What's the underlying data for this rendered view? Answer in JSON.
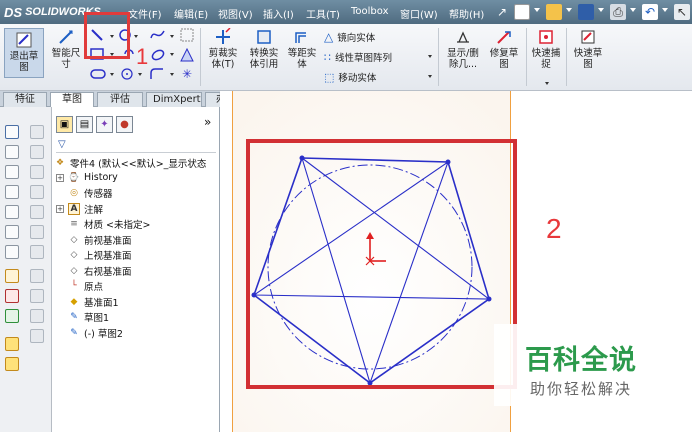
{
  "app": {
    "logo_text": "SOLIDWORKS",
    "logo_mark": "DS"
  },
  "menu": {
    "items": [
      "文件(F)",
      "编辑(E)",
      "视图(V)",
      "插入(I)",
      "工具(T)",
      "Toolbox",
      "窗口(W)",
      "帮助(H)"
    ]
  },
  "ribbon": {
    "exit_sketch": "退出草\n图",
    "smart_dimension": "智能尺\n寸",
    "trim": "剪裁实\n体(T)",
    "convert": "转换实\n体引用",
    "offset": "等距实\n体",
    "mirror": "镜向实体",
    "linear_pattern": "线性草图阵列",
    "move": "移动实体",
    "show_delete": "显示/删\n除几...",
    "repair": "修复草\n图",
    "quick_snap": "快速捕\n捉",
    "rapid_sketch": "快速草\n图"
  },
  "tabs": [
    "特征",
    "草图",
    "评估",
    "DimXpert",
    "办公室产品"
  ],
  "feature_tree": {
    "root": "零件4 (默认<<默认>_显示状态",
    "items": [
      {
        "label": "History",
        "icon": "history-icon",
        "expandable": true
      },
      {
        "label": "传感器",
        "icon": "sensor-icon",
        "expandable": false
      },
      {
        "label": "注解",
        "icon": "annotation-icon",
        "expandable": true
      },
      {
        "label": "材质 <未指定>",
        "icon": "material-icon",
        "expandable": false
      },
      {
        "label": "前视基准面",
        "icon": "plane-icon",
        "expandable": false
      },
      {
        "label": "上视基准面",
        "icon": "plane-icon",
        "expandable": false
      },
      {
        "label": "右视基准面",
        "icon": "plane-icon",
        "expandable": false
      },
      {
        "label": "原点",
        "icon": "origin-icon",
        "expandable": false
      },
      {
        "label": "基准面1",
        "icon": "plane-yellow-icon",
        "expandable": false
      },
      {
        "label": "草图1",
        "icon": "sketch-icon",
        "expandable": false
      },
      {
        "label": "(-) 草图2",
        "icon": "sketch-icon",
        "expandable": false
      }
    ]
  },
  "annotations": {
    "marker1": "1",
    "marker2": "2"
  },
  "watermark": {
    "title": "百科全说",
    "subtitle": "助你轻松解决"
  },
  "colors": {
    "highlight": "#d23034",
    "sketch_blue": "#2a2fc8",
    "origin_red": "#e02020",
    "watermark_green": "#2c9a4c"
  }
}
